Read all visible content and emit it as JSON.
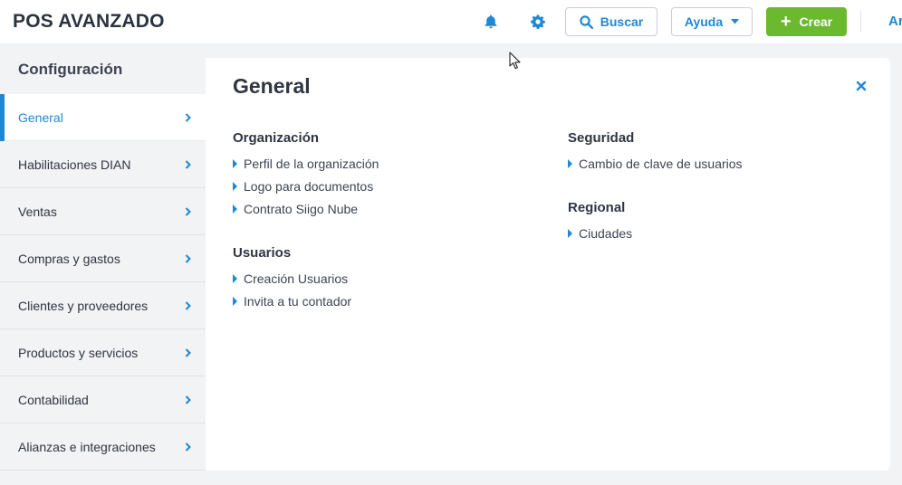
{
  "header": {
    "app_title": "POS AVANZADO",
    "search_label": "Buscar",
    "help_label": "Ayuda",
    "create_label": "Crear",
    "create_plus": "+",
    "user_abbr": "Ar",
    "icons": [
      "bell-icon",
      "gear-icon",
      "search-icon",
      "caret-down-icon"
    ]
  },
  "sidebar": {
    "title": "Configuración",
    "items": [
      {
        "label": "General",
        "active": true
      },
      {
        "label": "Habilitaciones DIAN"
      },
      {
        "label": "Ventas"
      },
      {
        "label": "Compras y gastos"
      },
      {
        "label": "Clientes y proveedores"
      },
      {
        "label": "Productos y servicios"
      },
      {
        "label": "Contabilidad"
      },
      {
        "label": "Alianzas e integraciones"
      }
    ]
  },
  "main": {
    "title": "General",
    "sections": {
      "organizacion": {
        "title": "Organización",
        "links": [
          "Perfil de la organización",
          "Logo para documentos",
          "Contrato Siigo Nube"
        ]
      },
      "usuarios": {
        "title": "Usuarios",
        "links": [
          "Creación Usuarios",
          "Invita a tu contador"
        ]
      },
      "seguridad": {
        "title": "Seguridad",
        "links": [
          "Cambio de clave de usuarios"
        ]
      },
      "regional": {
        "title": "Regional",
        "links": [
          "Ciudades"
        ]
      }
    }
  },
  "colors": {
    "accent": "#1f88d4",
    "create_button": "#6ab92f",
    "background": "#f2f3f5"
  }
}
